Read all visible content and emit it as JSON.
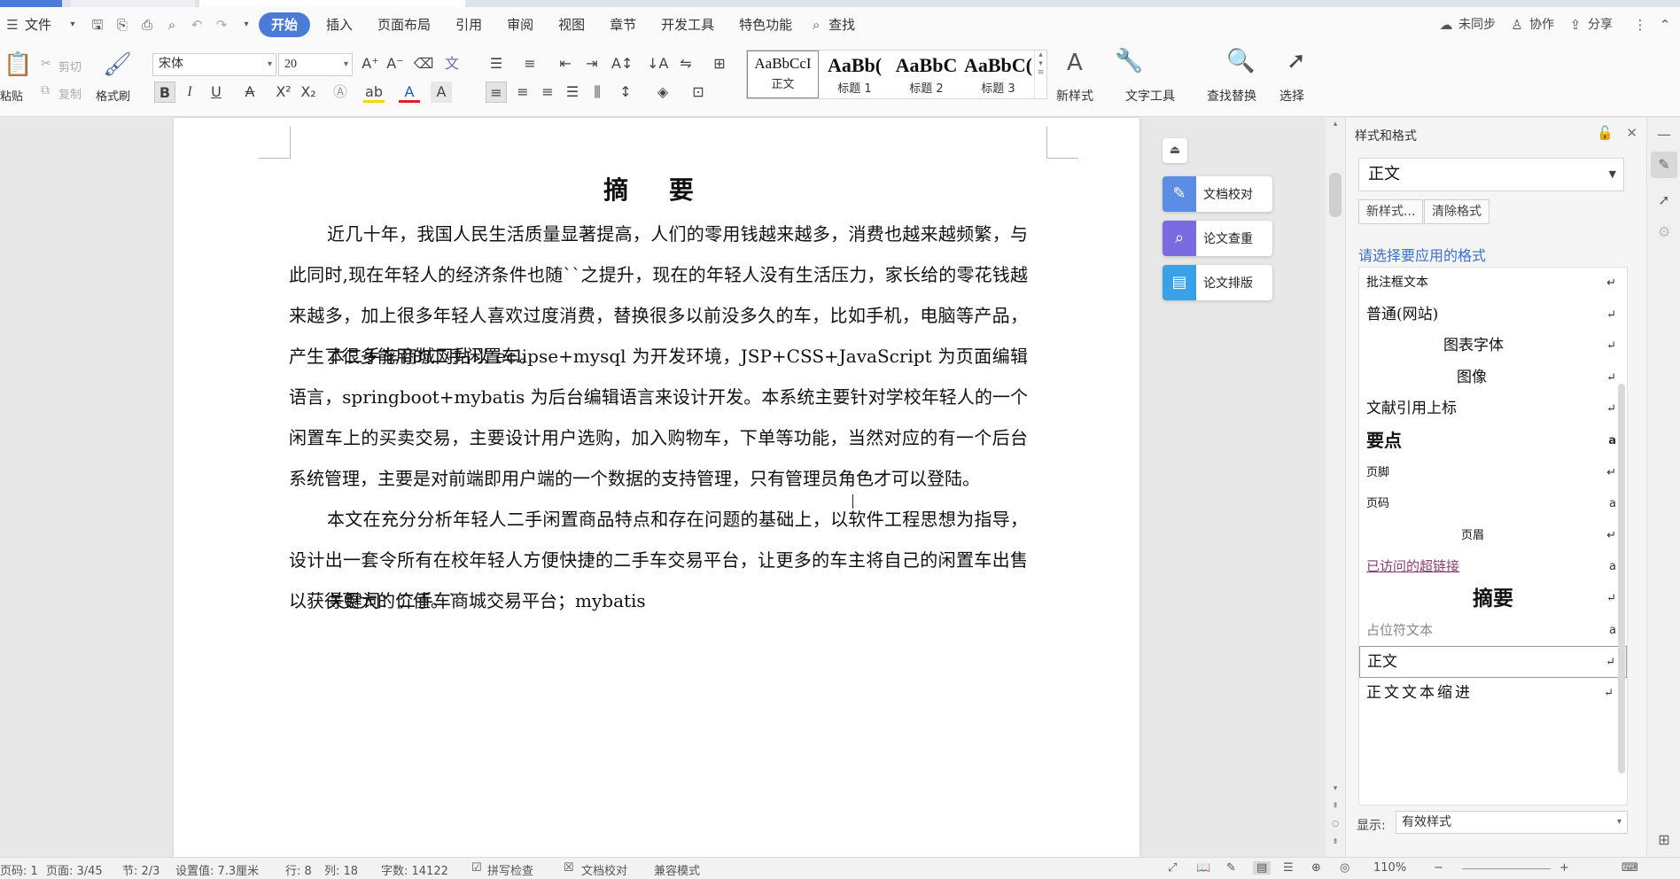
{
  "menubar": {
    "file_label": "文件",
    "tabs": [
      "开始",
      "插入",
      "页面布局",
      "引用",
      "审阅",
      "视图",
      "章节",
      "开发工具",
      "特色功能"
    ],
    "search_label": "查找",
    "sync_label": "未同步",
    "collab_label": "协作",
    "share_label": "分享"
  },
  "ribbon": {
    "paste_label": "粘贴",
    "cut_label": "剪切",
    "copy_label": "复制",
    "format_painter_label": "格式刷",
    "font_name": "宋体",
    "font_size": "20",
    "styles": [
      {
        "sample": "AaBbCcI",
        "name": "正文"
      },
      {
        "sample": "AaBb(",
        "name": "标题 1"
      },
      {
        "sample": "AaBbC",
        "name": "标题 2"
      },
      {
        "sample": "AaBbC(",
        "name": "标题 3"
      }
    ],
    "new_style_label": "新样式",
    "text_tools_label": "文字工具",
    "find_replace_label": "查找替换",
    "select_label": "选择"
  },
  "document": {
    "title": "摘 要",
    "paragraphs": [
      "近几十年，我国人民生活质量显著提高，人们的零用钱越来越多，消费也越来越频繁，与此同时,现在年轻人的经济条件也随``之提升，现在的年轻人没有生活压力，家长给的零花钱越来越多，加上很多年轻人喜欢过度消费，替换很多以前没多久的车，比如手机，电脑等产品，产生了很多能用的二手闲置车。",
      "本二手车商城网站以 eclipse+mysql 为开发环境，JSP+CSS+JavaScript 为页面编辑语言，springboot+mybatis 为后台编辑语言来设计开发。本系统主要针对学校年轻人的一个闲置车上的买卖交易，主要设计用户选购，加入购物车，下单等功能，当然对应的有一个后台系统管理，主要是对前端即用户端的一个数据的支持管理，只有管理员角色才可以登陆。",
      "本文在充分分析年轻人二手闲置商品特点和存在问题的基础上，以软件工程思想为指导，设计出一套令所有在校年轻人方便快捷的二手车交易平台，让更多的车主将自己的闲置车出售以获得更大的价值。`",
      "关键词：二手车商城交易平台；mybatis"
    ]
  },
  "float_buttons": {
    "proofread": "文档校对",
    "plagiarism": "论文查重",
    "layout": "论文排版"
  },
  "styles_panel": {
    "title": "样式和格式",
    "current_style": "正文",
    "new_style_btn": "新样式...",
    "clear_format_btn": "清除格式",
    "apply_hint": "请选择要应用的格式",
    "items": [
      {
        "label": "批注框文本",
        "mark": "↵"
      },
      {
        "label": "普通(网站)",
        "mark": "↵"
      },
      {
        "label": "图表字体",
        "mark": "↵"
      },
      {
        "label": "图像",
        "mark": "↵"
      },
      {
        "label": "文献引用上标",
        "mark": "↵"
      },
      {
        "label": "要点",
        "mark": "a"
      },
      {
        "label": "页脚",
        "mark": "↵"
      },
      {
        "label": "页码",
        "mark": "a"
      },
      {
        "label": "页眉",
        "mark": "↵"
      },
      {
        "label": "已访问的超链接",
        "mark": "a"
      },
      {
        "label": "摘要",
        "mark": "↵"
      },
      {
        "label": "占位符文本",
        "mark": "a"
      },
      {
        "label": "正文",
        "mark": "↵"
      },
      {
        "label": "正文文本缩进",
        "mark": "↵"
      }
    ],
    "show_label": "显示:",
    "show_value": "有效样式"
  },
  "statusbar": {
    "page_num": "页码: 1",
    "page": "页面: 3/45",
    "section": "节: 2/3",
    "setting": "设置值: 7.3厘米",
    "row": "行: 8",
    "col": "列: 18",
    "words": "字数: 14122",
    "spellcheck": "拼写检查",
    "doc_proof": "文档校对",
    "compat": "兼容模式",
    "zoom": "110%"
  }
}
